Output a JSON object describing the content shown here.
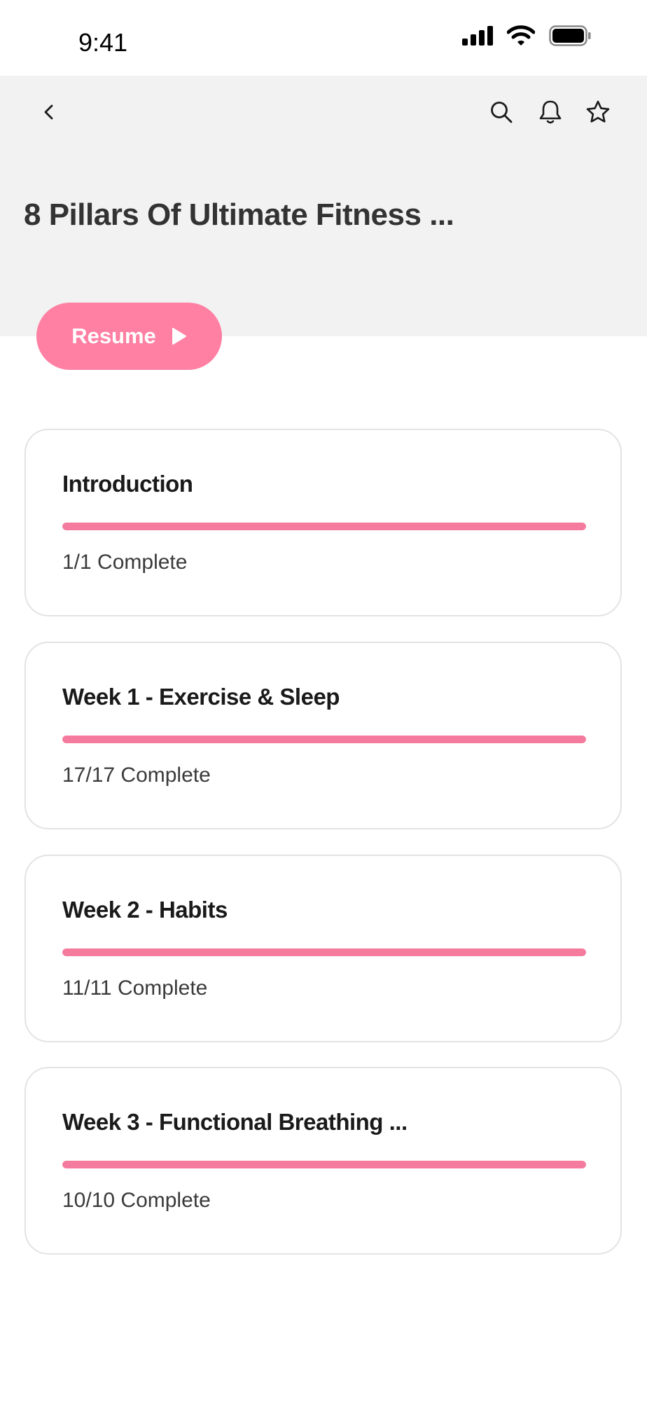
{
  "status_bar": {
    "time": "9:41"
  },
  "header": {
    "title": "8 Pillars Of Ultimate Fitness ..."
  },
  "resume_button": {
    "label": "Resume"
  },
  "accent_color": "#ff80a3",
  "progress_color": "#f47b9d",
  "modules": [
    {
      "title": "Introduction",
      "status": "1/1 Complete",
      "progress": 1.0
    },
    {
      "title": "Week 1 - Exercise & Sleep",
      "status": "17/17 Complete",
      "progress": 1.0
    },
    {
      "title": "Week 2 - Habits",
      "status": "11/11 Complete",
      "progress": 1.0
    },
    {
      "title": "Week 3 - Functional Breathing ...",
      "status": "10/10 Complete",
      "progress": 1.0
    }
  ]
}
